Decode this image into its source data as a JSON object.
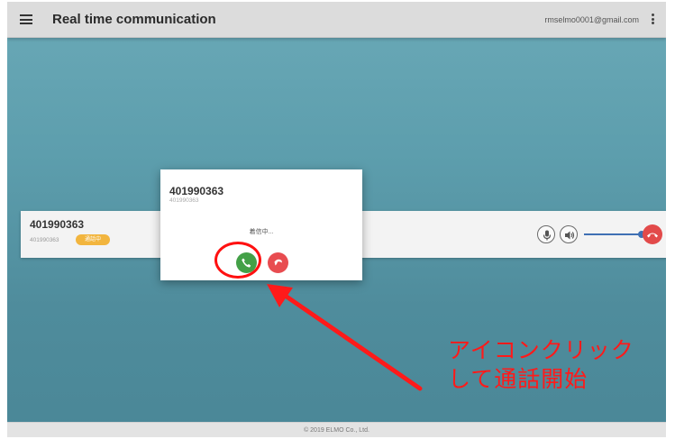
{
  "header": {
    "title": "Real time communication",
    "account": "rmselmo0001@gmail.com",
    "menu_icon": "hamburger-menu-icon",
    "more_icon": "more-vert-icon"
  },
  "call_bar": {
    "number": "401990363",
    "sub_number": "401990363",
    "badge": "通話中",
    "mic_icon": "microphone-icon",
    "speaker_icon": "speaker-icon",
    "volume": 0.95,
    "hangup_icon": "phone-hangup-icon"
  },
  "dialog": {
    "number": "401990363",
    "sub_number": "401990363",
    "status": "着信中...",
    "answer_icon": "phone-answer-icon",
    "decline_icon": "phone-decline-icon"
  },
  "footer": {
    "copyright": "© 2019 ELMO Co., Ltd."
  },
  "annotation": {
    "line1": "アイコンクリック",
    "line2": "して通話開始"
  },
  "colors": {
    "background": "#5d9ead",
    "answer": "#43a047",
    "decline": "#e84c50",
    "badge": "#f2b53e",
    "slider": "#3f70b4",
    "annotation": "#ff1a1a"
  }
}
